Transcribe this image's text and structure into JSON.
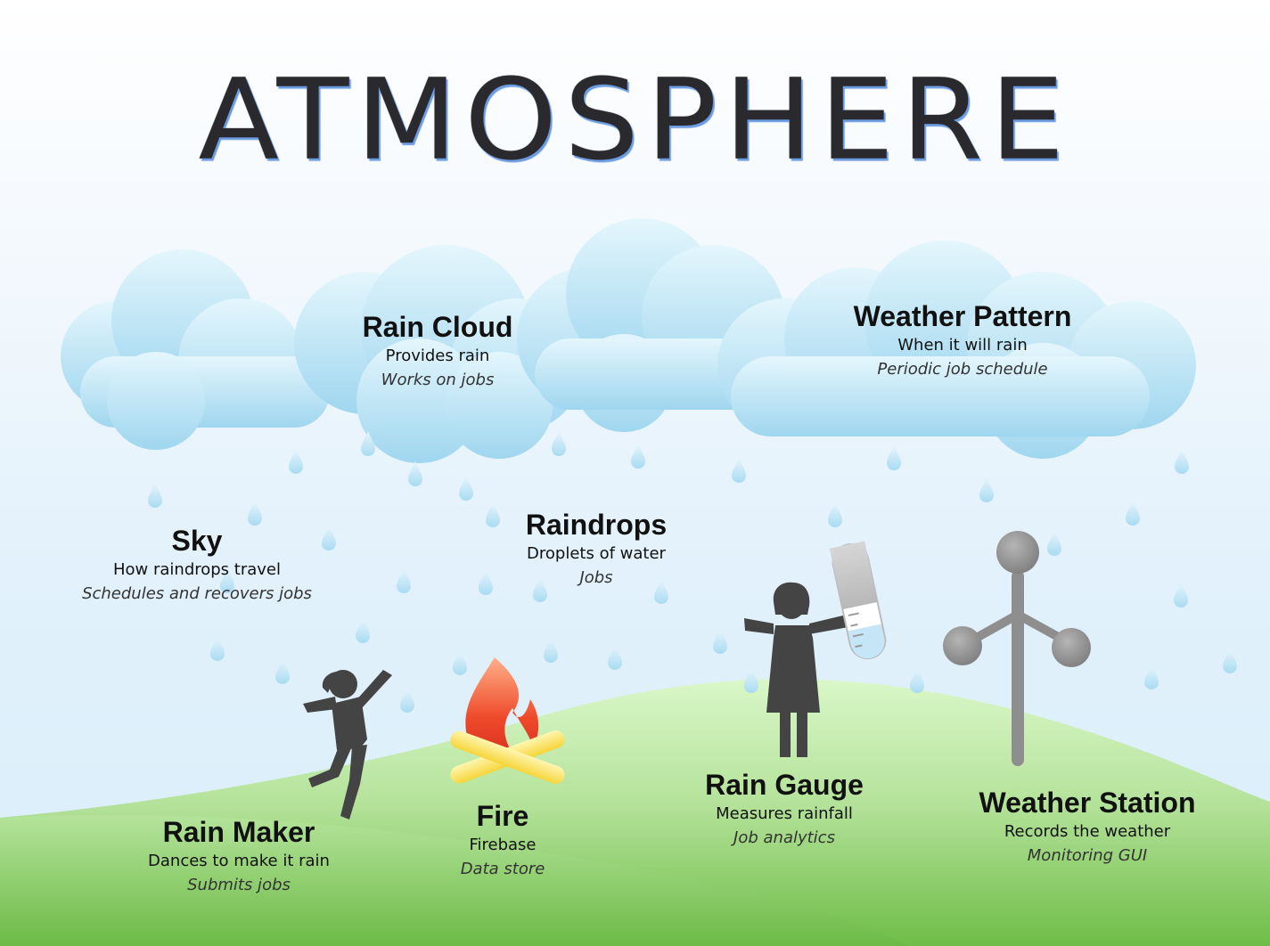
{
  "title": "ATMOSPHERE",
  "colors": {
    "cloud": "#a9dcf1",
    "raindrop": "#aadcf2",
    "hill": "#8fcf6c",
    "silhouette": "#424242",
    "flame": "#e8452b",
    "logs": "#ffe066",
    "station": "#8e8e8e"
  },
  "icons": [
    "cloud-icon",
    "raindrop-icon",
    "dancing-person-icon",
    "campfire-icon",
    "scientist-icon",
    "test-tube-icon",
    "anemometer-icon"
  ],
  "components": {
    "rain_cloud": {
      "name": "Rain Cloud",
      "desc": "Provides rain",
      "role": "Works on jobs"
    },
    "weather_pattern": {
      "name": "Weather Pattern",
      "desc": "When it will rain",
      "role": "Periodic job schedule"
    },
    "sky": {
      "name": "Sky",
      "desc": "How raindrops travel",
      "role": "Schedules and recovers jobs"
    },
    "raindrops": {
      "name": "Raindrops",
      "desc": "Droplets of water",
      "role": "Jobs"
    },
    "rain_maker": {
      "name": "Rain Maker",
      "desc": "Dances to make it rain",
      "role": "Submits jobs"
    },
    "fire": {
      "name": "Fire",
      "desc": "Firebase",
      "role": "Data store"
    },
    "rain_gauge": {
      "name": "Rain Gauge",
      "desc": "Measures rainfall",
      "role": "Job analytics"
    },
    "weather_station": {
      "name": "Weather Station",
      "desc": "Records the weather",
      "role": "Monitoring GUI"
    }
  }
}
